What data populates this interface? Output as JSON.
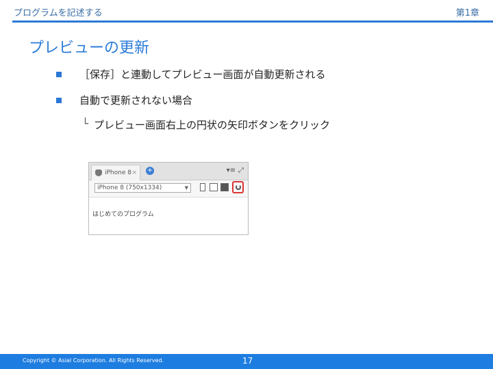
{
  "header": {
    "left": "プログラムを記述する",
    "right": "第1章"
  },
  "title": "プレビューの更新",
  "bullets": [
    "［保存］と連動してプレビュー画面が自動更新される",
    "自動で更新されない場合"
  ],
  "sub": {
    "mark": "└",
    "text": "プレビュー画面右上の円状の矢印ボタンをクリック"
  },
  "screenshot": {
    "tab_label": "iPhone 8",
    "tab_close": "×",
    "add": "+",
    "device": "iPhone 8 (750x1334)",
    "preview_text": "はじめてのプログラム",
    "icons": [
      "apple-icon",
      "add-tab-icon",
      "menu-icon",
      "fullscreen-icon",
      "portrait-icon",
      "landscape-icon",
      "screenshot-icon",
      "reload-icon"
    ]
  },
  "footer": {
    "copyright": "Copyright © Asial Corporation. All Rights Reserved.",
    "page": "17"
  },
  "colors": {
    "accent": "#2b78d6",
    "footer": "#1e7de0",
    "highlight": "#dd3333"
  }
}
